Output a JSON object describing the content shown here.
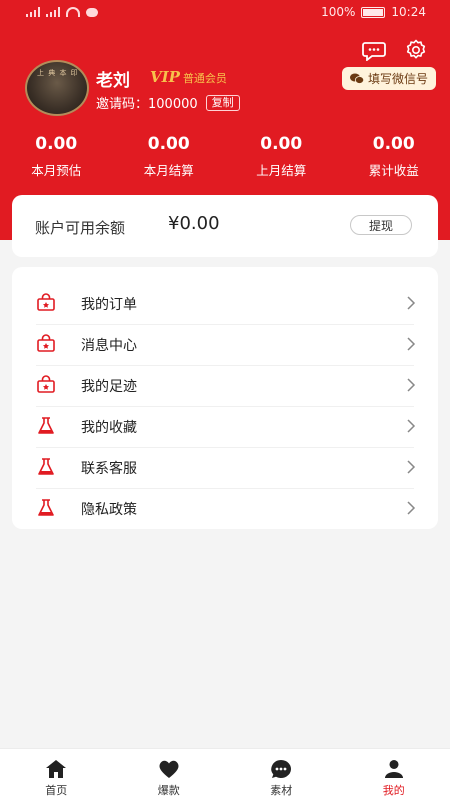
{
  "status_bar": {
    "battery": "100%",
    "time": "10:24"
  },
  "profile": {
    "name": "老刘",
    "vip_mark": "VIP",
    "vip_level": "普通会员",
    "invite_label": "邀请码：",
    "invite_code": "100000",
    "copy_label": "复制",
    "wechat_label": "填写微信号"
  },
  "stats": [
    {
      "value": "0.00",
      "label": "本月预估"
    },
    {
      "value": "0.00",
      "label": "本月结算"
    },
    {
      "value": "0.00",
      "label": "上月结算"
    },
    {
      "value": "0.00",
      "label": "累计收益"
    }
  ],
  "balance": {
    "label": "账户可用余额",
    "amount": "¥0.00",
    "withdraw_label": "提现"
  },
  "menu": [
    {
      "label": "我的订单",
      "icon": "bag-icon"
    },
    {
      "label": "消息中心",
      "icon": "bag-icon"
    },
    {
      "label": "我的足迹",
      "icon": "bag-icon"
    },
    {
      "label": "我的收藏",
      "icon": "flask-icon"
    },
    {
      "label": "联系客服",
      "icon": "flask-icon"
    },
    {
      "label": "隐私政策",
      "icon": "flask-icon"
    }
  ],
  "tabs": [
    {
      "label": "首页",
      "icon": "home-icon"
    },
    {
      "label": "爆款",
      "icon": "heart-icon"
    },
    {
      "label": "素材",
      "icon": "chat-icon"
    },
    {
      "label": "我的",
      "icon": "user-icon",
      "active": true
    }
  ],
  "colors": {
    "brand_red": "#e11b22",
    "vip_gold": "#f7c24c"
  }
}
